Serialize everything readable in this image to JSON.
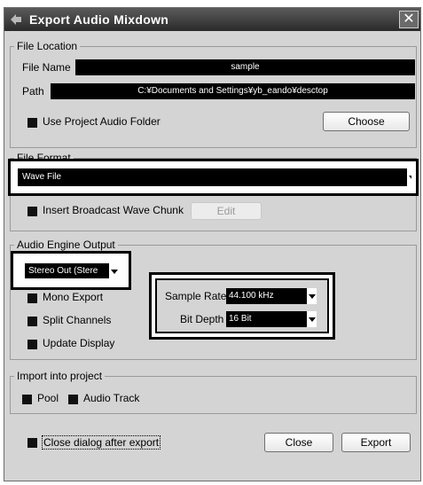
{
  "window": {
    "title": "Export Audio Mixdown",
    "close_glyph": "✕"
  },
  "file_location": {
    "legend": "File Location",
    "file_name_label": "File Name",
    "file_name_value": "sample",
    "path_label": "Path",
    "path_value": "C:¥Documents and Settings¥yb_eando¥desctop",
    "use_project_folder_label": "Use Project Audio Folder",
    "choose_button": "Choose"
  },
  "file_format": {
    "legend": "File Format",
    "format_value": "Wave File",
    "broadcast_label": "Insert Broadcast Wave Chunk",
    "edit_button": "Edit"
  },
  "audio_engine": {
    "legend": "Audio Engine Output",
    "output_value": "Stereo Out (Stere",
    "mono_export_label": "Mono Export",
    "split_channels_label": "Split Channels",
    "update_display_label": "Update Display",
    "sample_rate_label": "Sample Rate",
    "sample_rate_value": "44.100 kHz",
    "bit_depth_label": "Bit Depth",
    "bit_depth_value": "16 Bit"
  },
  "import_project": {
    "legend": "Import into project",
    "pool_label": "Pool",
    "audio_track_label": "Audio Track"
  },
  "footer": {
    "close_after_export_label": "Close dialog after export",
    "close_button": "Close",
    "export_button": "Export"
  },
  "icons": {
    "app": "cubase-logo-icon",
    "close": "close-icon",
    "dropdown": "chevron-down-icon"
  }
}
